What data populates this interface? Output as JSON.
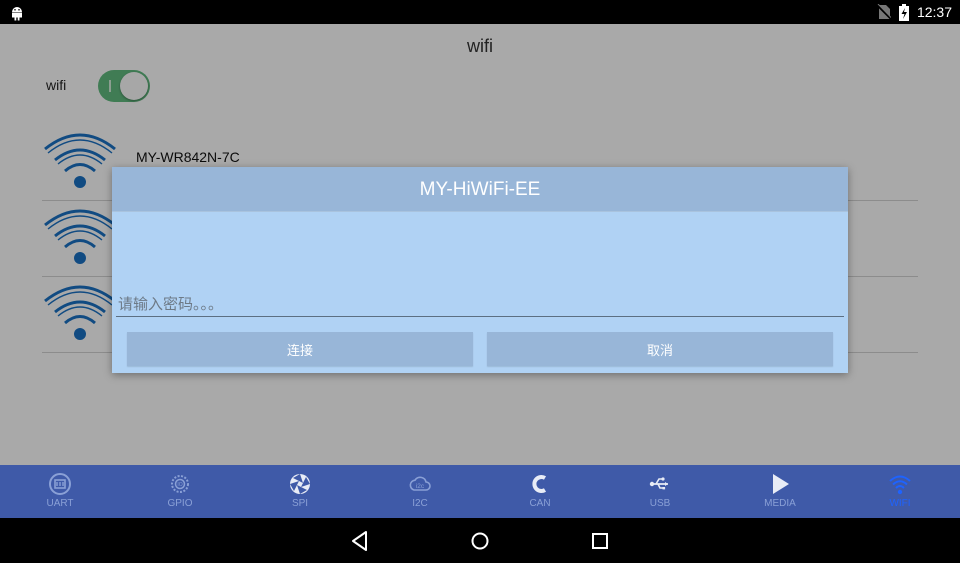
{
  "status_bar": {
    "time": "12:37",
    "left_icon": "android-debug-icon",
    "right_icons": [
      "no-sim-icon",
      "battery-charging-icon"
    ]
  },
  "app": {
    "title": "wifi",
    "wifi_toggle_label": "wifi",
    "wifi_enabled": true,
    "accent_color": "#5fb77d",
    "networks": [
      {
        "ssid": "MY-WR842N-7C",
        "icon": "wifi-signal-icon"
      },
      {
        "ssid": "",
        "icon": "wifi-signal-icon"
      },
      {
        "ssid": "",
        "icon": "wifi-signal-icon"
      }
    ]
  },
  "dialog": {
    "title": "MY-HiWiFi-EE",
    "password_placeholder": "请输入密码。。。",
    "password_value": "",
    "connect_label": "连接",
    "cancel_label": "取消",
    "background_color": "#b0d2f4",
    "header_color": "#98b6d8"
  },
  "tabs": [
    {
      "label": "UART",
      "icon": "uart-icon",
      "active": false
    },
    {
      "label": "GPIO",
      "icon": "gpio-icon",
      "active": false
    },
    {
      "label": "SPI",
      "icon": "spi-icon",
      "active": false
    },
    {
      "label": "I2C",
      "icon": "i2c-icon",
      "active": false
    },
    {
      "label": "CAN",
      "icon": "can-icon",
      "active": false
    },
    {
      "label": "USB",
      "icon": "usb-icon",
      "active": false
    },
    {
      "label": "MEDIA",
      "icon": "media-play-icon",
      "active": false
    },
    {
      "label": "WIFI",
      "icon": "wifi-icon",
      "active": true
    }
  ],
  "nav_bar": {
    "buttons": [
      "back-icon",
      "home-icon",
      "recents-icon"
    ]
  }
}
